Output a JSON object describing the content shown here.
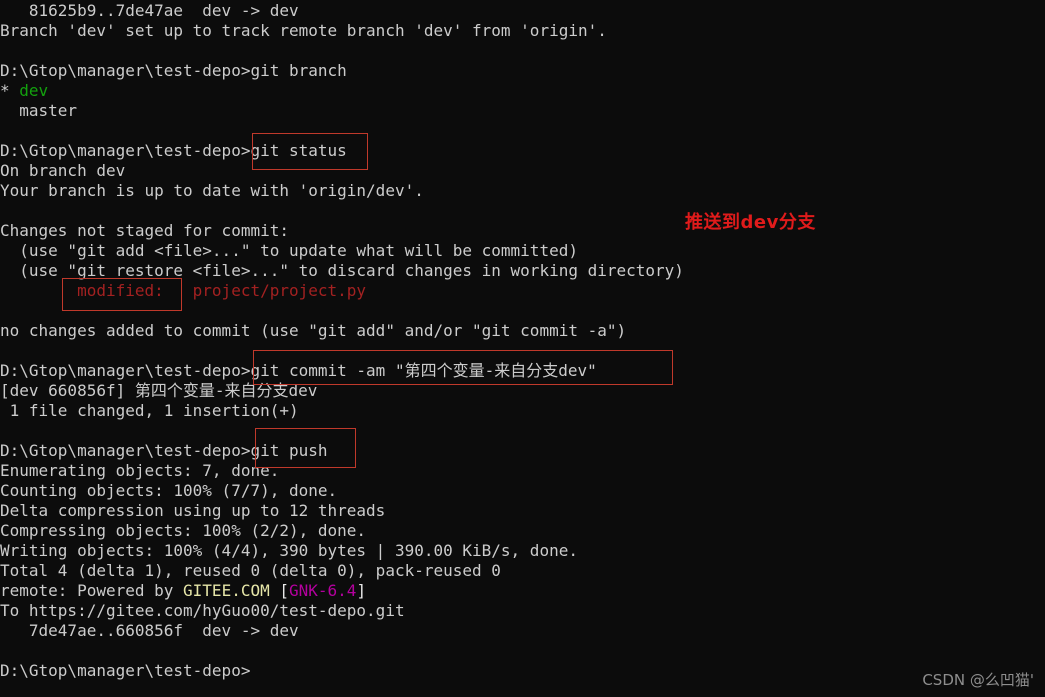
{
  "terminal": {
    "background_color": "#0c0c0c",
    "default_text_color": "#cccccc",
    "prompt": "D:\\Gtop\\manager\\test-depo>",
    "lines": [
      {
        "segments": [
          {
            "text": "   81625b9..7de47ae  dev -> dev",
            "color": "default"
          }
        ]
      },
      {
        "segments": [
          {
            "text": "Branch 'dev' set up to track remote branch 'dev' from 'origin'.",
            "color": "default"
          }
        ]
      },
      {
        "segments": [
          {
            "text": "",
            "color": "default"
          }
        ]
      },
      {
        "segments": [
          {
            "text": "D:\\Gtop\\manager\\test-depo>git branch",
            "color": "default"
          }
        ]
      },
      {
        "segments": [
          {
            "text": "* ",
            "color": "default"
          },
          {
            "text": "dev",
            "color": "green"
          }
        ]
      },
      {
        "segments": [
          {
            "text": "  master",
            "color": "default"
          }
        ]
      },
      {
        "segments": [
          {
            "text": "",
            "color": "default"
          }
        ]
      },
      {
        "segments": [
          {
            "text": "D:\\Gtop\\manager\\test-depo>git status",
            "color": "default"
          }
        ]
      },
      {
        "segments": [
          {
            "text": "On branch dev",
            "color": "default"
          }
        ]
      },
      {
        "segments": [
          {
            "text": "Your branch is up to date with 'origin/dev'.",
            "color": "default"
          }
        ]
      },
      {
        "segments": [
          {
            "text": "",
            "color": "default"
          }
        ]
      },
      {
        "segments": [
          {
            "text": "Changes not staged for commit:",
            "color": "default"
          }
        ]
      },
      {
        "segments": [
          {
            "text": "  (use \"git add <file>...\" to update what will be committed)",
            "color": "default"
          }
        ]
      },
      {
        "segments": [
          {
            "text": "  (use \"git restore <file>...\" to discard changes in working directory)",
            "color": "default"
          }
        ]
      },
      {
        "segments": [
          {
            "text": "        modified:   project/project.py",
            "color": "red"
          }
        ]
      },
      {
        "segments": [
          {
            "text": "",
            "color": "default"
          }
        ]
      },
      {
        "segments": [
          {
            "text": "no changes added to commit (use \"git add\" and/or \"git commit -a\")",
            "color": "default"
          }
        ]
      },
      {
        "segments": [
          {
            "text": "",
            "color": "default"
          }
        ]
      },
      {
        "segments": [
          {
            "text": "D:\\Gtop\\manager\\test-depo>git commit -am \"第四个变量-来自分支dev\"",
            "color": "default"
          }
        ]
      },
      {
        "segments": [
          {
            "text": "[dev 660856f] 第四个变量-来自分支dev",
            "color": "default"
          }
        ]
      },
      {
        "segments": [
          {
            "text": " 1 file changed, 1 insertion(+)",
            "color": "default"
          }
        ]
      },
      {
        "segments": [
          {
            "text": "",
            "color": "default"
          }
        ]
      },
      {
        "segments": [
          {
            "text": "D:\\Gtop\\manager\\test-depo>git push",
            "color": "default"
          }
        ]
      },
      {
        "segments": [
          {
            "text": "Enumerating objects: 7, done.",
            "color": "default"
          }
        ]
      },
      {
        "segments": [
          {
            "text": "Counting objects: 100% (7/7), done.",
            "color": "default"
          }
        ]
      },
      {
        "segments": [
          {
            "text": "Delta compression using up to 12 threads",
            "color": "default"
          }
        ]
      },
      {
        "segments": [
          {
            "text": "Compressing objects: 100% (2/2), done.",
            "color": "default"
          }
        ]
      },
      {
        "segments": [
          {
            "text": "Writing objects: 100% (4/4), 390 bytes | 390.00 KiB/s, done.",
            "color": "default"
          }
        ]
      },
      {
        "segments": [
          {
            "text": "Total 4 (delta 1), reused 0 (delta 0), pack-reused 0",
            "color": "default"
          }
        ]
      },
      {
        "segments": [
          {
            "text": "remote: Powered by ",
            "color": "default"
          },
          {
            "text": "GITEE.COM",
            "color": "yellow"
          },
          {
            "text": " [",
            "color": "white"
          },
          {
            "text": "GNK-6.4",
            "color": "magenta"
          },
          {
            "text": "]",
            "color": "white"
          }
        ]
      },
      {
        "segments": [
          {
            "text": "To https://gitee.com/hyGuo00/test-depo.git",
            "color": "default"
          }
        ]
      },
      {
        "segments": [
          {
            "text": "   7de47ae..660856f  dev -> dev",
            "color": "default"
          }
        ]
      },
      {
        "segments": [
          {
            "text": "",
            "color": "default"
          }
        ]
      },
      {
        "segments": [
          {
            "text": "D:\\Gtop\\manager\\test-depo>",
            "color": "default"
          }
        ]
      }
    ]
  },
  "annotations": {
    "note_text": "推送到dev分支",
    "note_color": "#e01b1b",
    "box_color": "#c0392b",
    "boxes": [
      {
        "id": "box-status",
        "label": "git status"
      },
      {
        "id": "box-modified",
        "label": "modified:"
      },
      {
        "id": "box-commit",
        "label": "git commit -am \"第四个变量-来自分支dev\""
      },
      {
        "id": "box-push",
        "label": "git push"
      }
    ]
  },
  "watermark": {
    "text": "CSDN @么凹猫'",
    "color": "#8e8e8e"
  }
}
